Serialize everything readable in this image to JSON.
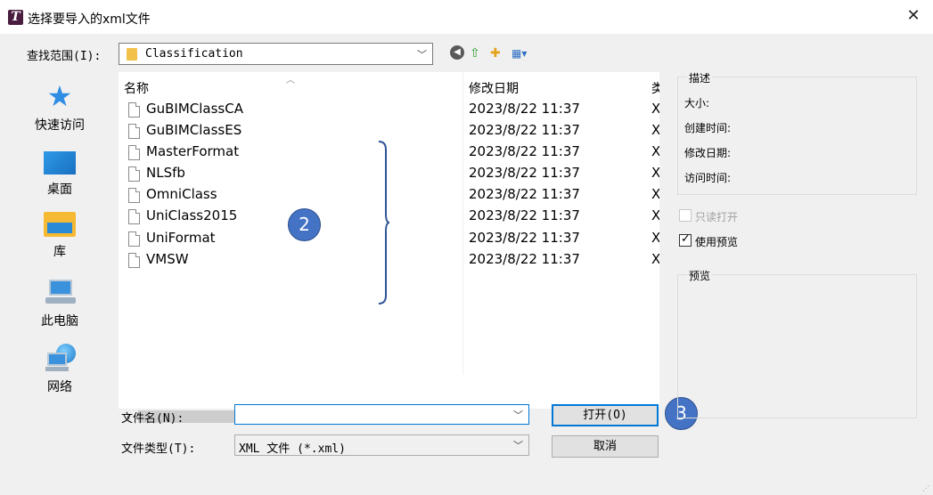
{
  "window": {
    "title": "选择要导入的xml文件",
    "close_glyph": "✕",
    "app_icon_letter": "T"
  },
  "look_in": {
    "label": "查找范围(I):",
    "value": "Classification"
  },
  "toolbar": {
    "icons": [
      "back-icon",
      "up-folder-icon",
      "new-folder-icon",
      "view-menu-icon"
    ]
  },
  "places": [
    {
      "label": "快速访问",
      "icon": "quick-access-star-icon"
    },
    {
      "label": "桌面",
      "icon": "desktop-icon"
    },
    {
      "label": "库",
      "icon": "library-icon"
    },
    {
      "label": "此电脑",
      "icon": "this-pc-icon"
    },
    {
      "label": "网络",
      "icon": "network-icon"
    }
  ],
  "file_list": {
    "columns": [
      "名称",
      "修改日期",
      "类"
    ],
    "rows": [
      {
        "name": "GuBIMClassCA",
        "date": "2023/8/22 11:37",
        "type": "X"
      },
      {
        "name": "GuBIMClassES",
        "date": "2023/8/22 11:37",
        "type": "X"
      },
      {
        "name": "MasterFormat",
        "date": "2023/8/22 11:37",
        "type": "X"
      },
      {
        "name": "NLSfb",
        "date": "2023/8/22 11:37",
        "type": "X"
      },
      {
        "name": "OmniClass",
        "date": "2023/8/22 11:37",
        "type": "X"
      },
      {
        "name": "UniClass2015",
        "date": "2023/8/22 11:37",
        "type": "X"
      },
      {
        "name": "UniFormat",
        "date": "2023/8/22 11:37",
        "type": "X"
      },
      {
        "name": "VMSW",
        "date": "2023/8/22 11:37",
        "type": "X"
      }
    ]
  },
  "annotations": {
    "badge_files": "2",
    "badge_open": "3",
    "badge_color": "#4472c4"
  },
  "file_name": {
    "label": "文件名(N):",
    "value": ""
  },
  "file_type": {
    "label": "文件类型(T):",
    "value": "XML 文件 (*.xml)"
  },
  "buttons": {
    "open": "打开(O)",
    "cancel": "取消"
  },
  "details": {
    "title": "描述",
    "size": "大小:",
    "created": "创建时间:",
    "modified": "修改日期:",
    "accessed": "访问时间:"
  },
  "options": {
    "readonly_label": "只读打开",
    "readonly_checked": false,
    "preview_label": "使用预览",
    "preview_checked": true
  },
  "preview": {
    "title": "预览"
  },
  "colors": {
    "accent": "#0078d7",
    "dialog_bg": "#f0f0f0"
  }
}
